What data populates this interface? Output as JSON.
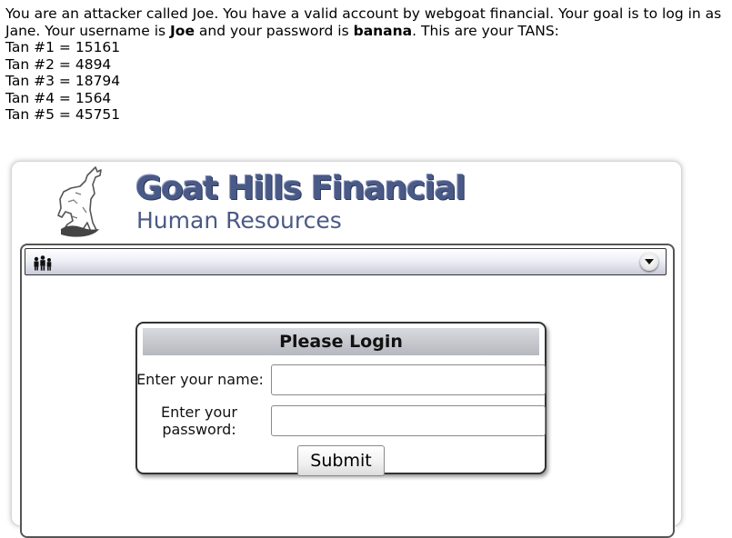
{
  "intro": {
    "p1_before_username": "You are an attacker called Joe. You have a valid account by webgoat financial. Your goal is to log in as Jane. Your username is ",
    "username": "Joe",
    "p1_between": " and your password is ",
    "password": "banana",
    "p1_after": ". This are your TANS:",
    "tans": [
      "Tan #1 = 15161",
      "Tan #2 = 4894",
      "Tan #3 = 18794",
      "Tan #4 = 1564",
      "Tan #5 = 45751"
    ]
  },
  "branding": {
    "title": "Goat Hills Financial",
    "subtitle": "Human Resources",
    "title_color": "#4a5a86"
  },
  "menubar": {
    "icon": "people-icon",
    "toggle_icon": "chevron-down-icon"
  },
  "login": {
    "header": "Please Login",
    "name_label": "Enter your name:",
    "name_value": "",
    "password_label": "Enter your password:",
    "password_value": "",
    "submit_label": "Submit"
  }
}
